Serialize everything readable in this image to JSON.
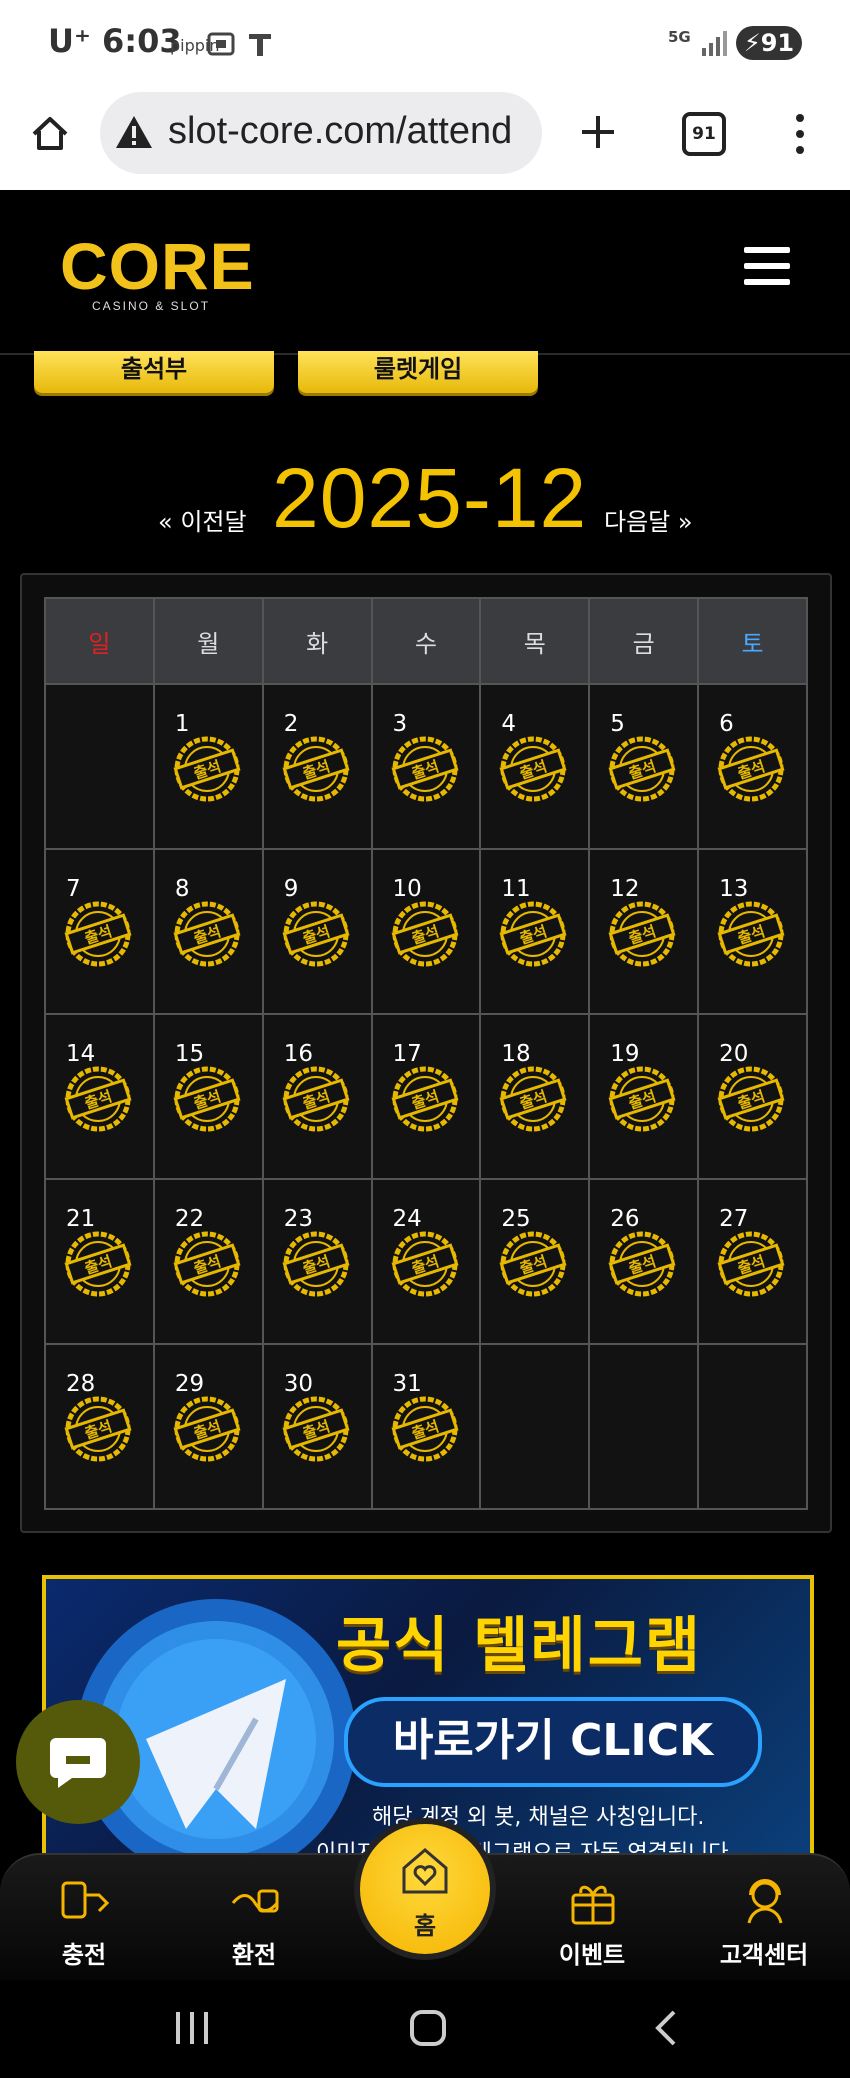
{
  "status_bar": {
    "carrier": "U⁺",
    "time": "6:03",
    "app_hint": "pippin",
    "network": "5G",
    "battery": "91"
  },
  "browser": {
    "url": "slot-core.com/attend",
    "tab_count": "91"
  },
  "site": {
    "logo_text": "CORE",
    "logo_subtext": "CASINO & SLOT"
  },
  "tabs": [
    {
      "label": "출석부"
    },
    {
      "label": "룰렛게임"
    }
  ],
  "calendar": {
    "prev_label": "« 이전달",
    "next_label": "다음달 »",
    "month": "2025-12",
    "weekdays": [
      "일",
      "월",
      "화",
      "수",
      "목",
      "금",
      "토"
    ],
    "weekday_colors": [
      "#e02020",
      "#dddddd",
      "#dddddd",
      "#dddddd",
      "#dddddd",
      "#dddddd",
      "#4aa8ff"
    ],
    "first_weekday": 1,
    "days_in_month": 31,
    "attended_days": [
      1,
      2,
      3,
      4,
      5,
      6,
      7,
      8,
      9,
      10,
      11,
      12,
      13,
      14,
      15,
      16,
      17,
      18,
      19,
      20,
      21,
      22,
      23,
      24,
      25,
      26,
      27,
      28,
      29,
      30,
      31
    ],
    "stamp_text": "출석"
  },
  "banner": {
    "title": "공식 텔레그램",
    "button": "바로가기 CLICK",
    "note1": "해당 계정 외 봇, 채널은 사칭입니다.",
    "note2": "이미지 클릭시 텔레그램으로 자동 연결됩니다."
  },
  "bottom_nav": {
    "deposit": "충전",
    "withdraw": "환전",
    "home": "홈",
    "event": "이벤트",
    "support": "고객센터"
  }
}
